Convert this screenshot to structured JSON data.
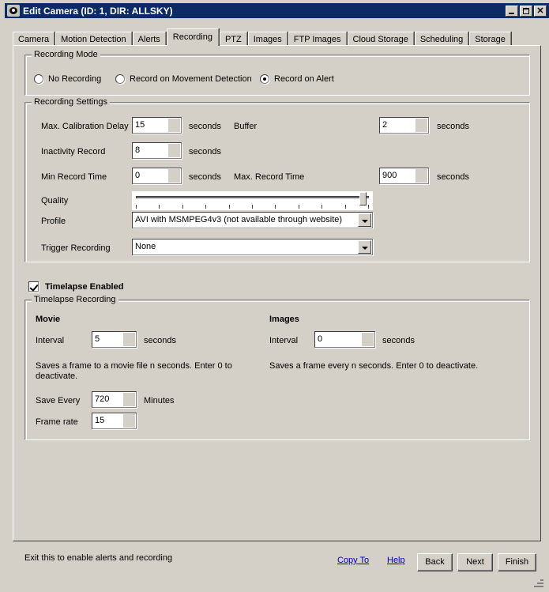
{
  "window": {
    "title": "Edit Camera (ID: 1, DIR: ALLSKY)",
    "icon": "camera-eye-icon",
    "minimize_label": "_",
    "maximize_label": "□",
    "close_label": "✕",
    "titlebar_color": "#0c2a66",
    "face_color": "#d4d0c8"
  },
  "tabs": [
    {
      "label": "Camera",
      "active": false
    },
    {
      "label": "Motion Detection",
      "active": false
    },
    {
      "label": "Alerts",
      "active": false
    },
    {
      "label": "Recording",
      "active": true
    },
    {
      "label": "PTZ",
      "active": false
    },
    {
      "label": "Images",
      "active": false
    },
    {
      "label": "FTP Images",
      "active": false
    },
    {
      "label": "Cloud Storage",
      "active": false
    },
    {
      "label": "Scheduling",
      "active": false
    },
    {
      "label": "Storage",
      "active": false
    }
  ],
  "recording_mode": {
    "group_title": "Recording Mode",
    "options": [
      {
        "label": "No Recording",
        "selected": false
      },
      {
        "label": "Record on Movement Detection",
        "selected": false
      },
      {
        "label": "Record on Alert",
        "selected": true
      }
    ]
  },
  "recording_settings": {
    "group_title": "Recording Settings",
    "max_calibration_delay": {
      "label": "Max. Calibration Delay",
      "value": "15",
      "unit": "seconds"
    },
    "buffer": {
      "label": "Buffer",
      "value": "2",
      "unit": "seconds"
    },
    "inactivity_record": {
      "label": "Inactivity Record",
      "value": "8",
      "unit": "seconds"
    },
    "min_record_time": {
      "label": "Min Record Time",
      "value": "0",
      "unit": "seconds"
    },
    "max_record_time": {
      "label": "Max. Record Time",
      "value": "900",
      "unit": "seconds"
    },
    "quality": {
      "label": "Quality",
      "value": 100,
      "min": 0,
      "max": 100,
      "ticks": 10
    },
    "profile": {
      "label": "Profile",
      "value": "AVI with MSMPEG4v3 (not available through website)"
    },
    "trigger_recording": {
      "label": "Trigger Recording",
      "value": "None"
    }
  },
  "timelapse": {
    "enabled_label": "Timelapse Enabled",
    "enabled": true,
    "group_title": "Timelapse Recording",
    "movie": {
      "heading": "Movie",
      "interval_label": "Interval",
      "interval_value": "5",
      "interval_unit": "seconds",
      "help_line1": "Saves a frame to a movie file n seconds. Enter 0 to",
      "help_line2": "deactivate.",
      "save_every_label": "Save Every",
      "save_every_value": "720",
      "save_every_unit": "Minutes",
      "frame_rate_label": "Frame rate",
      "frame_rate_value": "15"
    },
    "images": {
      "heading": "Images",
      "interval_label": "Interval",
      "interval_value": "0",
      "interval_unit": "seconds",
      "help_line1": "Saves a frame every n seconds. Enter 0 to deactivate."
    }
  },
  "footer": {
    "status": "Exit this to enable alerts and recording",
    "copy_to": "Copy To",
    "help": "Help",
    "back": "Back",
    "next": "Next",
    "finish": "Finish",
    "link_color": "#0000c0"
  }
}
